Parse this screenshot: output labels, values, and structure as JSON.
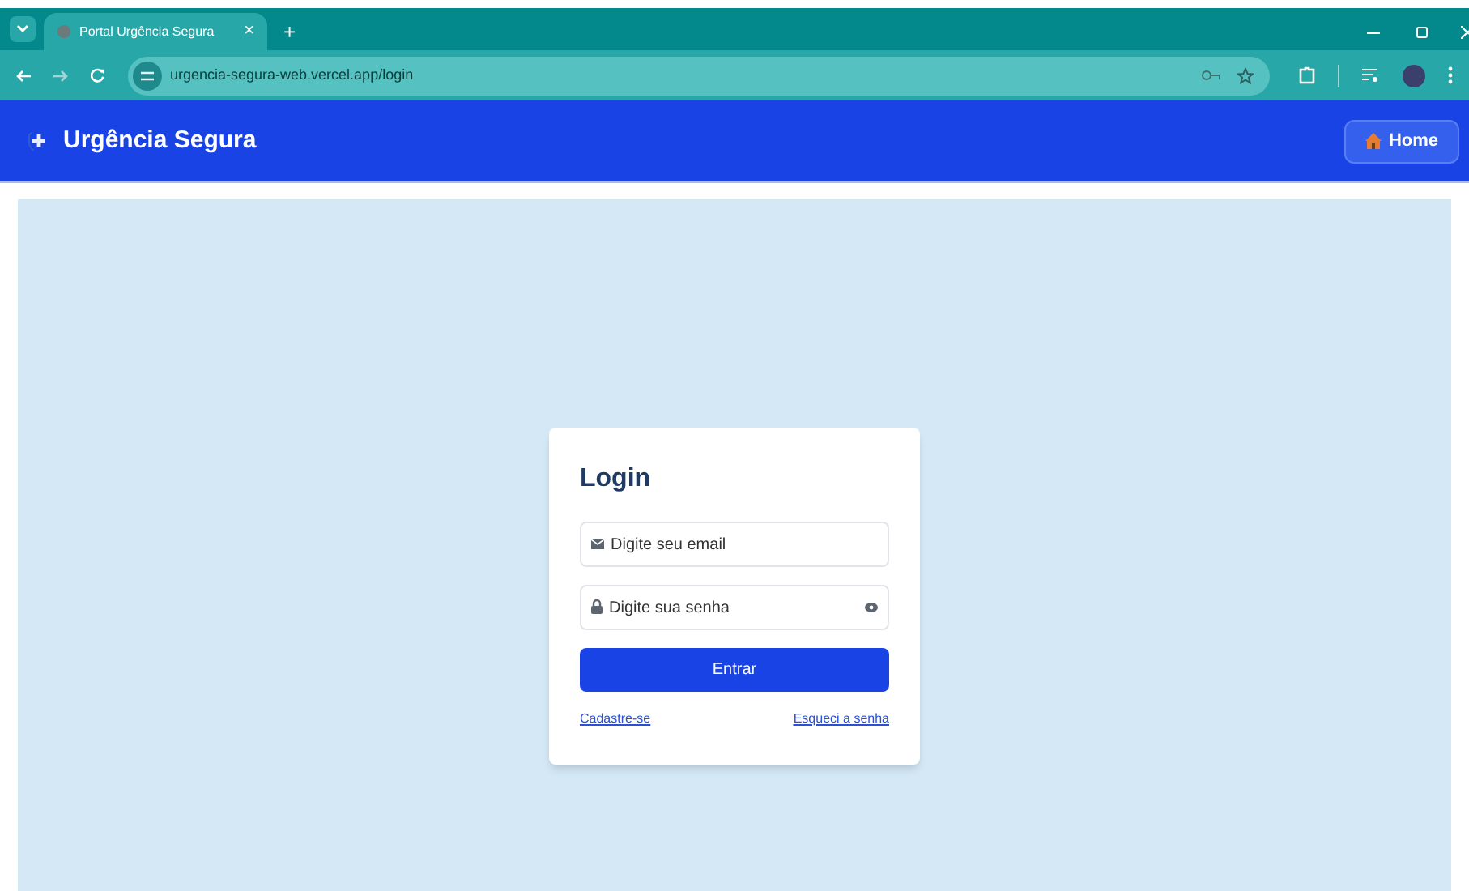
{
  "browser": {
    "tab_title": "Portal Urgência Segura",
    "tab_close": "×",
    "new_tab": "+",
    "url": "urgencia-segura-web.vercel.app/login"
  },
  "header": {
    "brand": "Urgência Segura",
    "home_button": "Home"
  },
  "login": {
    "title": "Login",
    "email": {
      "placeholder": "Digite seu email"
    },
    "password": {
      "placeholder": "Digite sua senha"
    },
    "submit": "Entrar",
    "links": [
      "Cadastre-se",
      "Esqueci a senha"
    ]
  }
}
